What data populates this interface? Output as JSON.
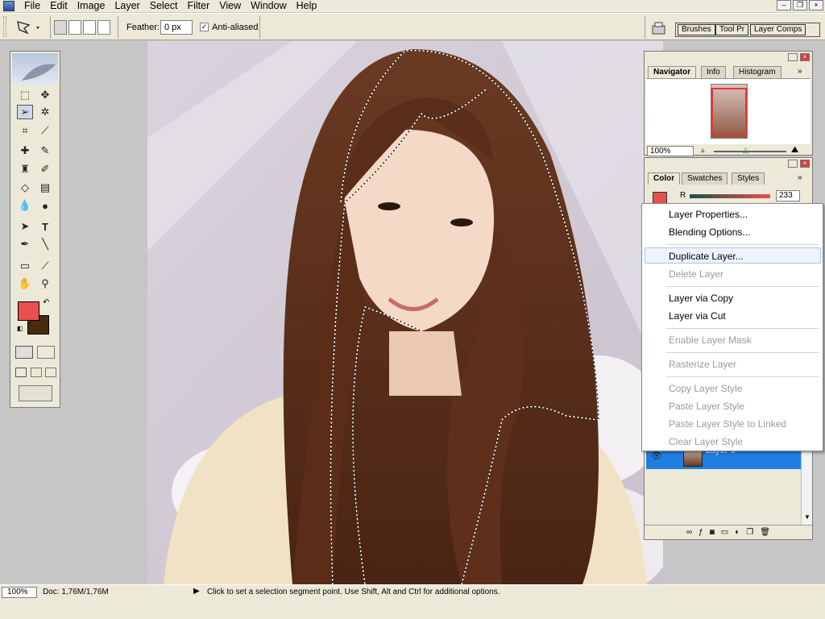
{
  "menu": {
    "items": [
      "File",
      "Edit",
      "Image",
      "Layer",
      "Select",
      "Filter",
      "View",
      "Window",
      "Help"
    ]
  },
  "window_buttons": {
    "minimize": "–",
    "restore": "❐",
    "close": "×"
  },
  "options": {
    "feather_label": "Feather:",
    "feather_value": "0 px",
    "anti_aliased_label": "Anti-aliased",
    "anti_aliased_checked": true,
    "well_tabs": [
      "Brushes",
      "Tool Pr",
      "Layer Comps"
    ]
  },
  "navigator": {
    "tabs": [
      "Navigator",
      "Info",
      "Histogram"
    ],
    "zoom": "100%"
  },
  "color_panel": {
    "tabs": [
      "Color",
      "Swatches",
      "Styles"
    ],
    "r_label": "R",
    "r_value": "233"
  },
  "layers_panel": {
    "layer_name": "Layer 0"
  },
  "context_menu": {
    "items": [
      {
        "label": "Layer Properties...",
        "enabled": true
      },
      {
        "label": "Blending Options...",
        "enabled": true
      },
      {
        "label": "Duplicate Layer...",
        "enabled": true,
        "highlighted": true
      },
      {
        "label": "Delete Layer",
        "enabled": false
      },
      {
        "label": "Layer via Copy",
        "enabled": true
      },
      {
        "label": "Layer via Cut",
        "enabled": true
      },
      {
        "label": "Enable Layer Mask",
        "enabled": false
      },
      {
        "label": "Rasterize Layer",
        "enabled": false
      },
      {
        "label": "Copy Layer Style",
        "enabled": false
      },
      {
        "label": "Paste Layer Style",
        "enabled": false
      },
      {
        "label": "Paste Layer Style to Linked",
        "enabled": false
      },
      {
        "label": "Clear Layer Style",
        "enabled": false
      }
    ]
  },
  "colors": {
    "foreground": "#e94f4f",
    "background": "#4a2a0c",
    "selection_highlight": "#1e7fe0"
  },
  "status": {
    "zoom": "100%",
    "doc": "Doc: 1,76M/1,76M",
    "hint": "Click to set a selection segment point.  Use Shift, Alt and Ctrl for additional options."
  }
}
